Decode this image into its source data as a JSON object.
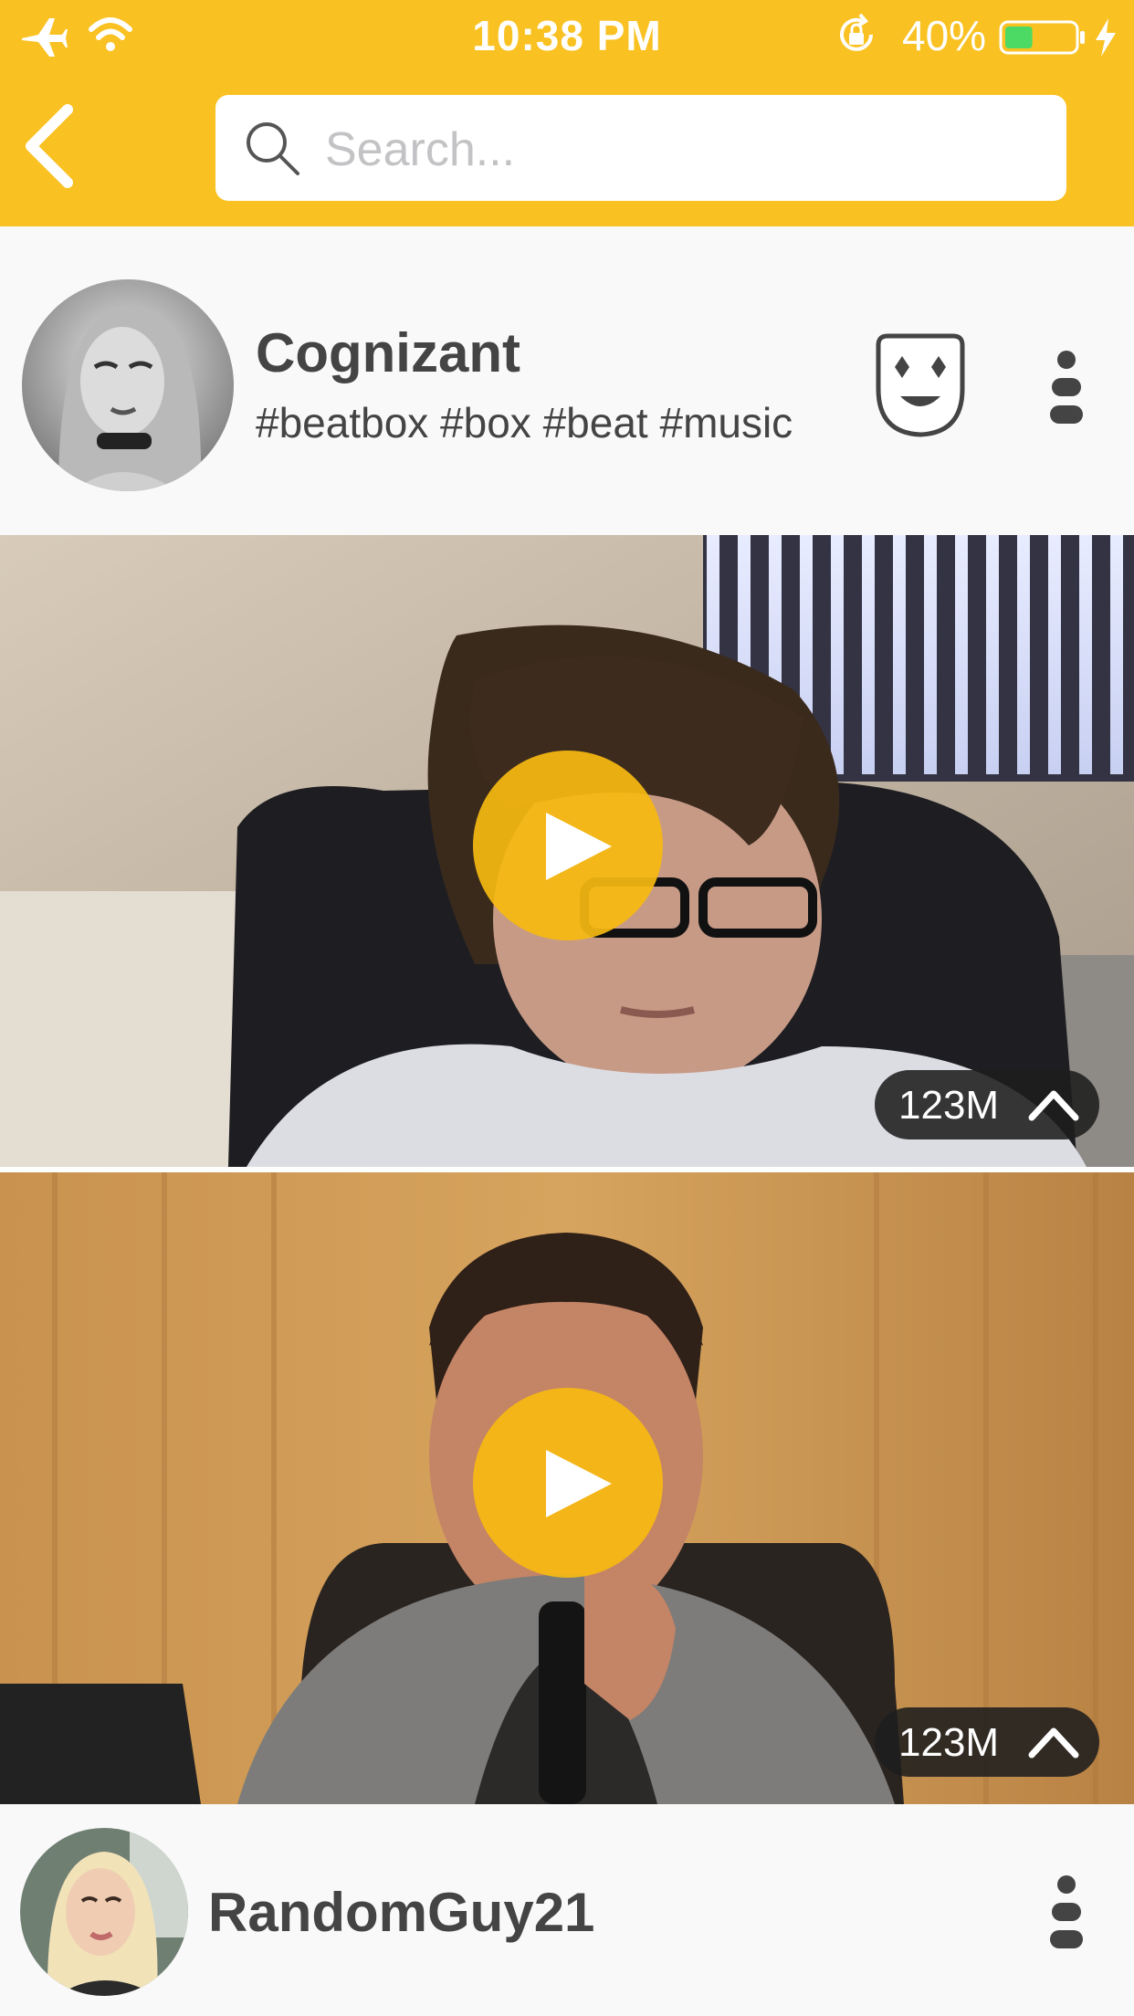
{
  "status_bar": {
    "time": "10:38 PM",
    "battery_percent": "40%",
    "battery_level": 0.4,
    "icons": [
      "airplane-mode-icon",
      "wifi-icon",
      "orientation-lock-icon",
      "battery-icon",
      "charging-bolt-icon"
    ]
  },
  "header": {
    "search_placeholder": "Search..."
  },
  "colors": {
    "brand_yellow": "#f9c122",
    "play_yellow": "#f6ba11",
    "text_dark": "#444444",
    "battery_green": "#4cd964"
  },
  "posts": [
    {
      "username": "Cognizant",
      "hashtags": "#beatbox #box #beat #music",
      "actions": [
        "mask-icon",
        "more-icon"
      ]
    }
  ],
  "videos": [
    {
      "count": "123M"
    },
    {
      "count": "123M"
    }
  ],
  "next_post": {
    "username": "RandomGuy21"
  }
}
